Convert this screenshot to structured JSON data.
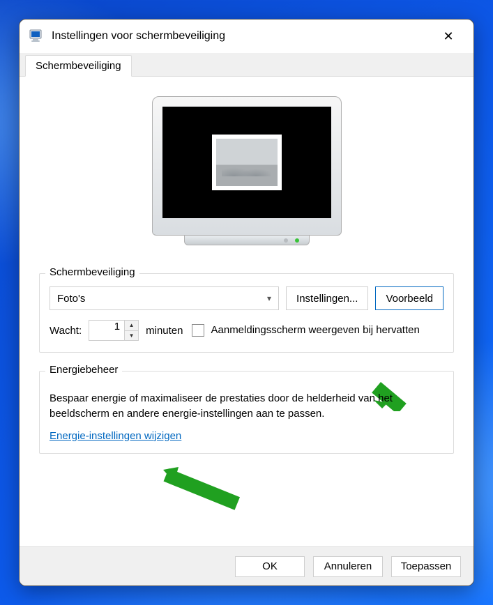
{
  "window": {
    "title": "Instellingen voor schermbeveiliging",
    "close_glyph": "✕"
  },
  "tabs": {
    "main": "Schermbeveiliging"
  },
  "screensaver": {
    "group_title": "Schermbeveiliging",
    "selected": "Foto's",
    "settings_btn": "Instellingen...",
    "preview_btn": "Voorbeeld",
    "wait_label": "Wacht:",
    "wait_value": "1",
    "minutes_label": "minuten",
    "resume_checkbox": "Aanmeldingsscherm weergeven bij hervatten"
  },
  "power": {
    "group_title": "Energiebeheer",
    "text": "Bespaar energie of maximaliseer de prestaties door de helderheid van het beeldscherm en andere energie-instellingen aan te passen.",
    "link": "Energie-instellingen wijzigen"
  },
  "footer": {
    "ok": "OK",
    "cancel": "Annuleren",
    "apply": "Toepassen"
  }
}
